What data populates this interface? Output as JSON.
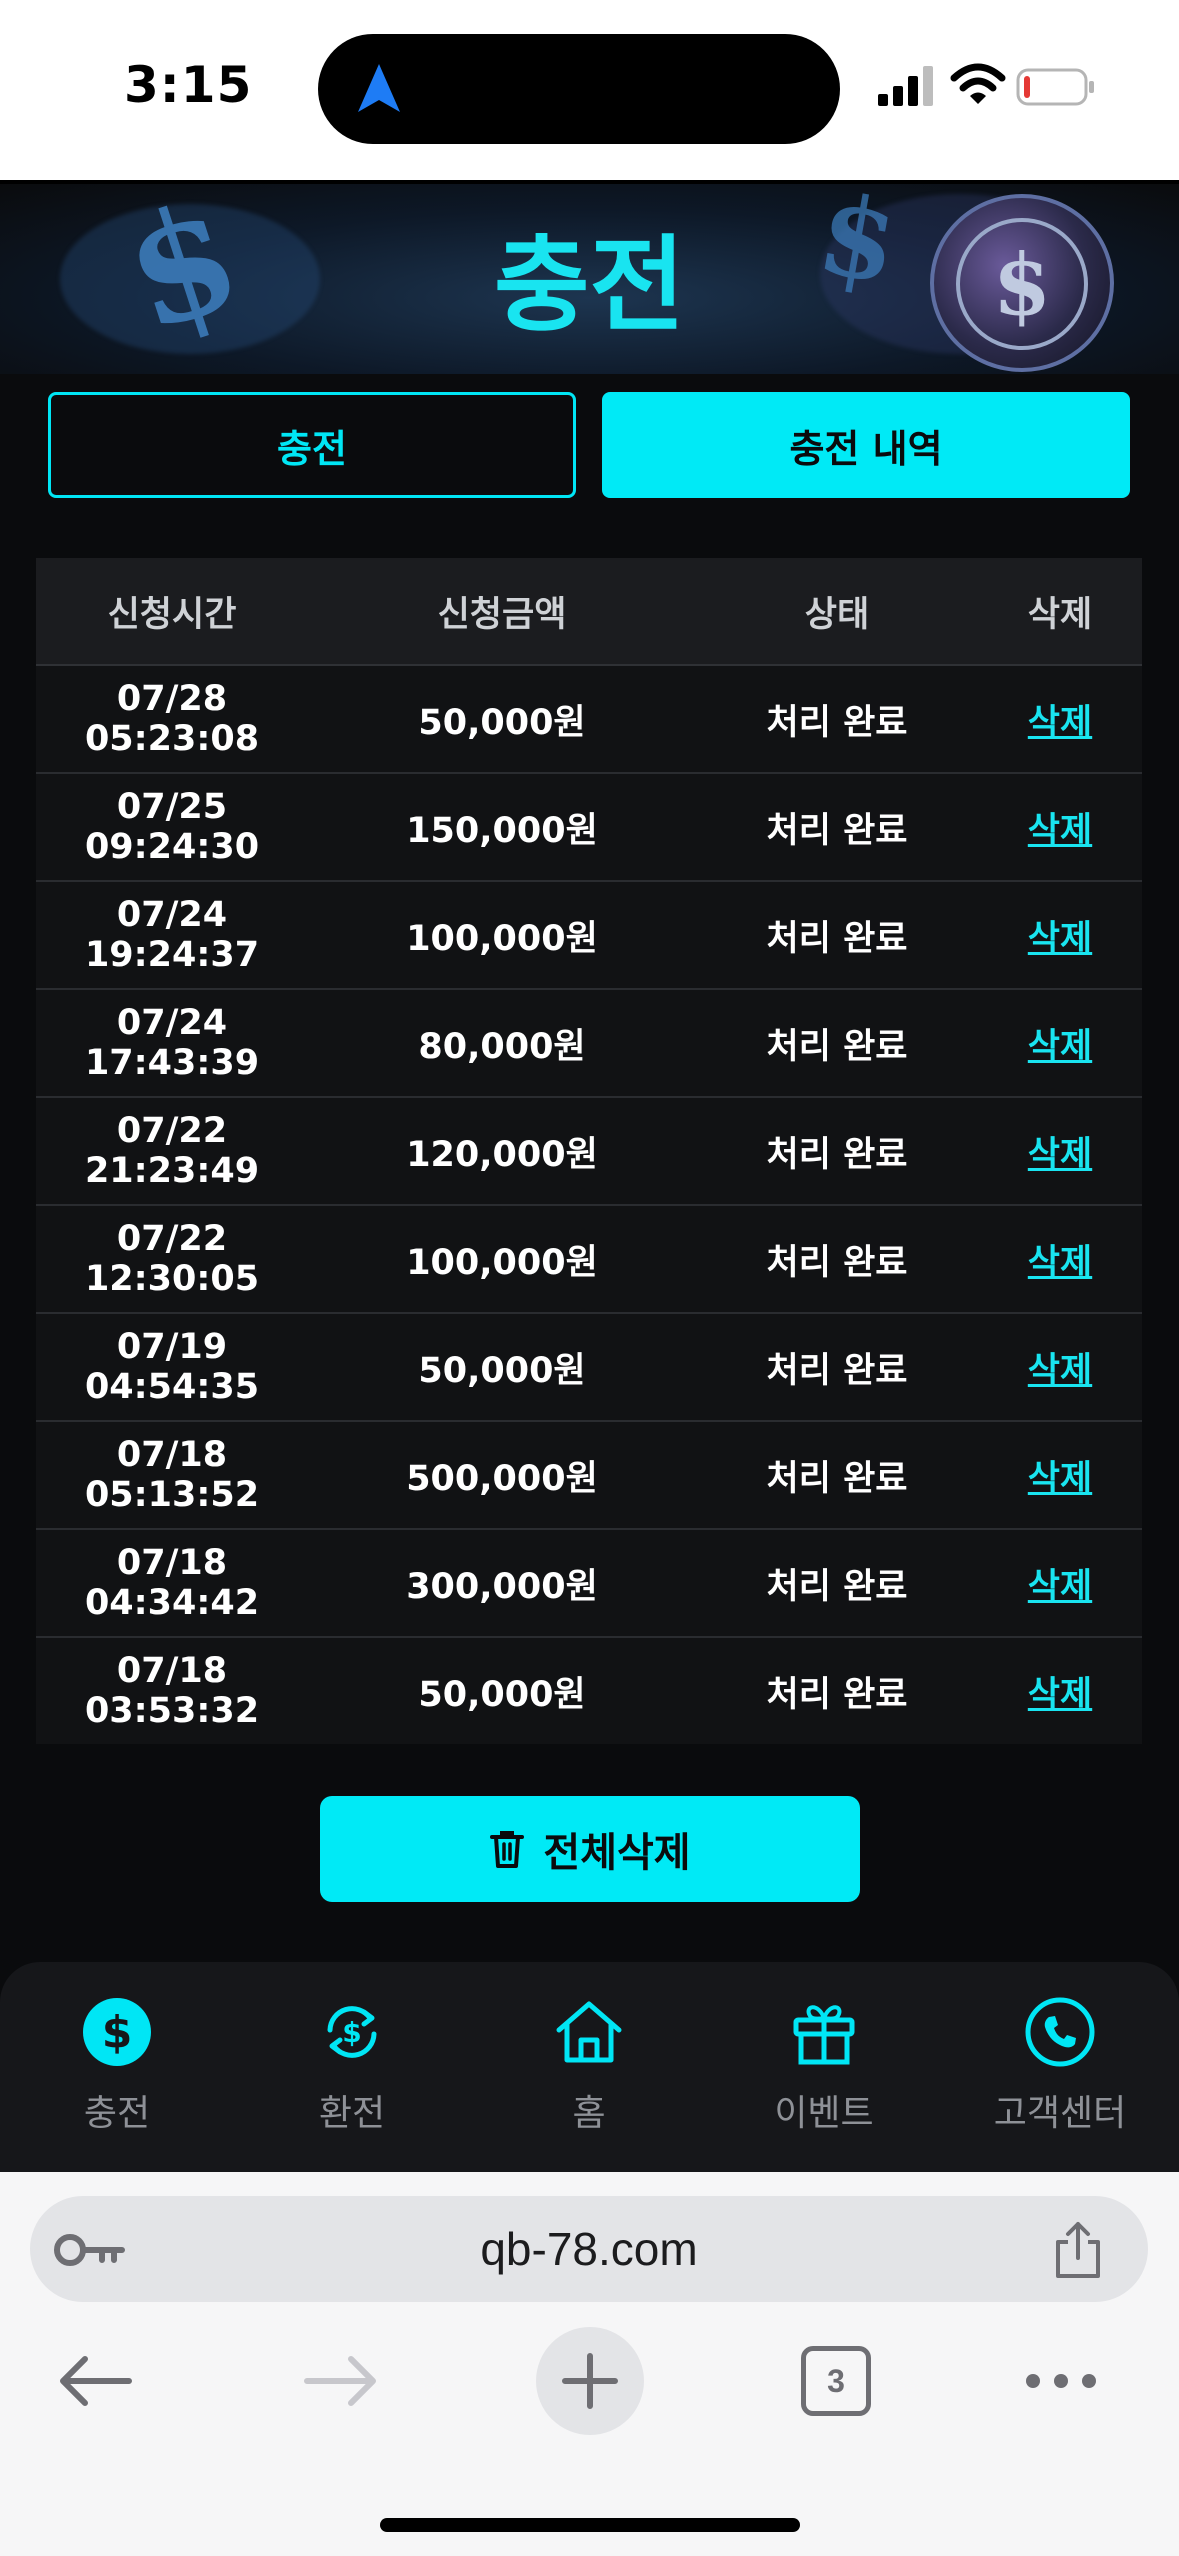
{
  "status_bar": {
    "time": "3:15",
    "icons": [
      "location-arrow-icon",
      "signal-icon",
      "wifi-icon",
      "battery-low-icon"
    ],
    "battery_color": "#e53935"
  },
  "page": {
    "title": "충전",
    "accent_color": "#00eaf6",
    "tabs": [
      {
        "label": "충전",
        "active": false
      },
      {
        "label": "충전 내역",
        "active": true
      }
    ]
  },
  "history_table": {
    "columns": [
      "신청시간",
      "신청금액",
      "상태",
      "삭제"
    ],
    "rows": [
      {
        "date": "07/28",
        "time": "05:23:08",
        "amount": "50,000원",
        "status": "처리 완료",
        "action": "삭제"
      },
      {
        "date": "07/25",
        "time": "09:24:30",
        "amount": "150,000원",
        "status": "처리 완료",
        "action": "삭제"
      },
      {
        "date": "07/24",
        "time": "19:24:37",
        "amount": "100,000원",
        "status": "처리 완료",
        "action": "삭제"
      },
      {
        "date": "07/24",
        "time": "17:43:39",
        "amount": "80,000원",
        "status": "처리 완료",
        "action": "삭제"
      },
      {
        "date": "07/22",
        "time": "21:23:49",
        "amount": "120,000원",
        "status": "처리 완료",
        "action": "삭제"
      },
      {
        "date": "07/22",
        "time": "12:30:05",
        "amount": "100,000원",
        "status": "처리 완료",
        "action": "삭제"
      },
      {
        "date": "07/19",
        "time": "04:54:35",
        "amount": "50,000원",
        "status": "처리 완료",
        "action": "삭제"
      },
      {
        "date": "07/18",
        "time": "05:13:52",
        "amount": "500,000원",
        "status": "처리 완료",
        "action": "삭제"
      },
      {
        "date": "07/18",
        "time": "04:34:42",
        "amount": "300,000원",
        "status": "처리 완료",
        "action": "삭제"
      },
      {
        "date": "07/18",
        "time": "03:53:32",
        "amount": "50,000원",
        "status": "처리 완료",
        "action": "삭제"
      }
    ]
  },
  "delete_all": {
    "label": "전체삭제",
    "icon": "trash-icon"
  },
  "bottom_nav": {
    "items": [
      {
        "label": "충전",
        "icon": "dollar-circle-icon",
        "active": true
      },
      {
        "label": "환전",
        "icon": "exchange-icon",
        "active": false
      },
      {
        "label": "홈",
        "icon": "home-icon",
        "active": false
      },
      {
        "label": "이벤트",
        "icon": "gift-icon",
        "active": false
      },
      {
        "label": "고객센터",
        "icon": "phone-icon",
        "active": false
      }
    ]
  },
  "browser": {
    "url": "qb-78.com",
    "tab_count": "3",
    "icons": [
      "key-icon",
      "share-icon",
      "back-icon",
      "forward-icon",
      "new-tab-icon",
      "tabs-icon",
      "more-icon"
    ]
  }
}
